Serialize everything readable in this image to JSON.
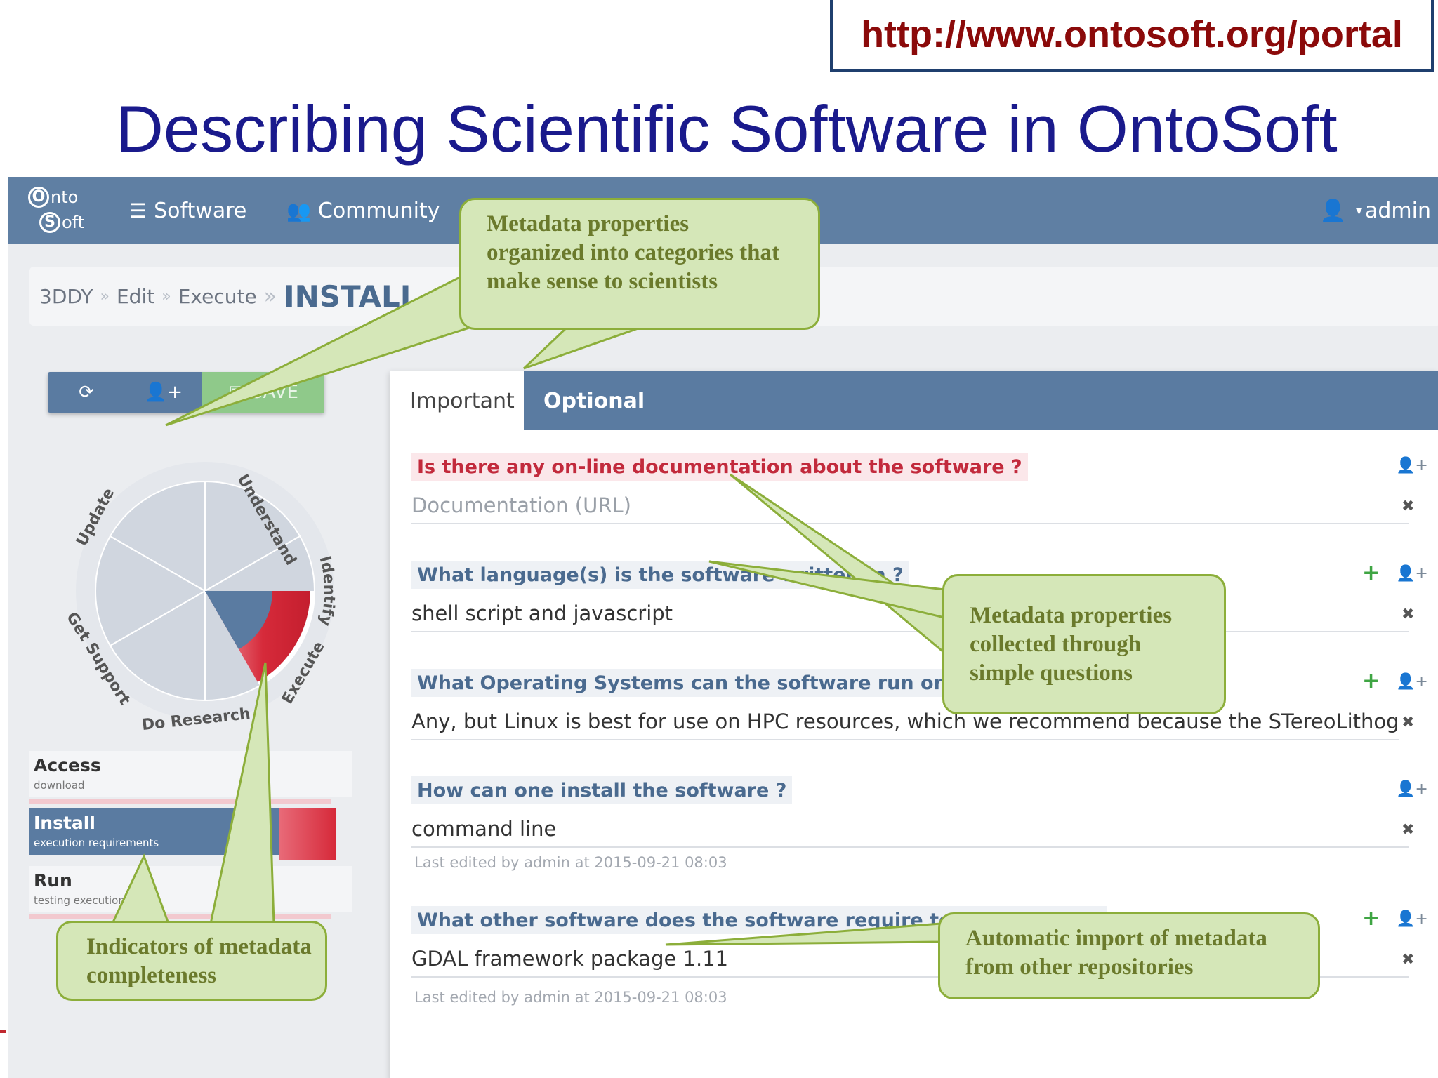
{
  "header_url": "http://www.ontosoft.org/portal",
  "slide_title": "Describing Scientific Software in OntoSoft",
  "navbar": {
    "logo_top": "nto",
    "logo_bottom": "oft",
    "logo_o": "O",
    "logo_s": "S",
    "items": [
      {
        "icon": "database-icon",
        "label": "Software"
      },
      {
        "icon": "users-icon",
        "label": "Community"
      }
    ],
    "user": "admin"
  },
  "breadcrumb": {
    "items": [
      "3DDY",
      "Edit",
      "Execute"
    ],
    "active": "INSTALL"
  },
  "toolbar": {
    "save_label": "SAVE"
  },
  "wheel": {
    "segments": [
      "Identify",
      "Understand",
      "Execute",
      "Do Research",
      "Get Support",
      "Update"
    ],
    "active_segment": "Execute",
    "colors": {
      "inactive": "#d0d6df",
      "active_blue": "#5a7ba1",
      "active_red": "#d62a3a"
    }
  },
  "sidebar": {
    "items": [
      {
        "title": "Access",
        "subtitle": "download"
      },
      {
        "title": "Install",
        "subtitle": "execution requirements"
      },
      {
        "title": "Run",
        "subtitle": "testing execution"
      }
    ]
  },
  "tabs": {
    "important": "Important",
    "optional": "Optional"
  },
  "questions": [
    {
      "question": "Is there any on-line documentation about the software ?",
      "answer": "",
      "placeholder": "Documentation (URL)",
      "edited": ""
    },
    {
      "question": "What language(s) is the software written in ?",
      "answer": "shell script and javascript",
      "placeholder": "",
      "edited": ""
    },
    {
      "question": "What Operating Systems can the software run on ?",
      "answer": "Any, but Linux is best for use on HPC resources, which we recommend because the STereoLithography fil",
      "placeholder": "",
      "edited": ""
    },
    {
      "question": "How can one install the software ?",
      "answer": "command line",
      "placeholder": "",
      "edited": "Last edited by admin at 2015-09-21 08:03"
    },
    {
      "question": "What other software does the software require to be installed ?",
      "answer": "GDAL framework package 1.11",
      "placeholder": "",
      "edited": "Last edited by admin at 2015-09-21 08:03"
    }
  ],
  "callouts": {
    "categories": [
      "Metadata properties",
      "organized into categories that",
      "make sense to scientists"
    ],
    "questions": [
      "Metadata properties",
      "collected through",
      "simple  questions"
    ],
    "completeness": [
      "Indicators of metadata",
      "completeness"
    ],
    "import": [
      "Automatic import of metadata",
      "from other repositories"
    ]
  },
  "colors": {
    "navbar": "#5f7fa3",
    "title_blue": "#1a1a8c",
    "url_red": "#8b0a0a",
    "callout_fill": "#d5e7b8",
    "callout_border": "#8cae3a",
    "callout_text": "#6b7a2c"
  }
}
